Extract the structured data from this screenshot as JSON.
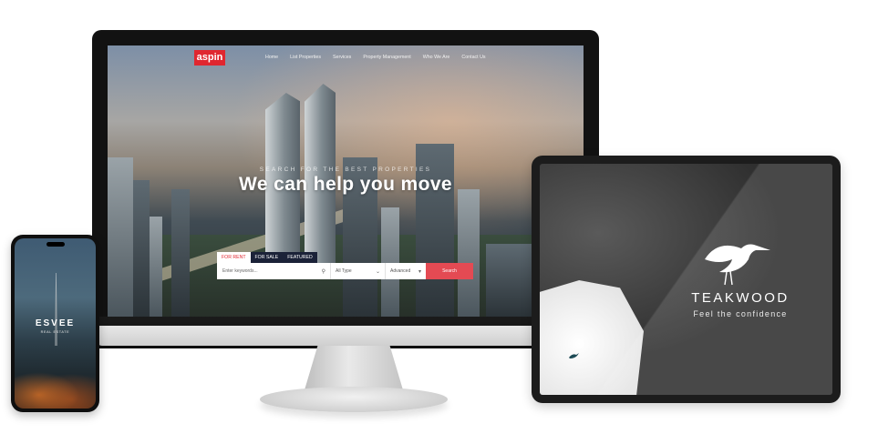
{
  "desktop": {
    "site": {
      "logo": "aspin",
      "nav": [
        "Home",
        "List Properties",
        "Services",
        "Property Management",
        "Who We Are",
        "Contact Us"
      ],
      "hero_subtitle": "SEARCH FOR THE BEST PROPERTIES",
      "hero_title": "We can help you move",
      "search": {
        "tabs": [
          {
            "label": "FOR RENT",
            "active": true
          },
          {
            "label": "FOR SALE",
            "active": false
          },
          {
            "label": "FEATURED",
            "active": false
          }
        ],
        "keyword_placeholder": "Enter keywords...",
        "type_selected": "All Type",
        "advanced_label": "Advanced",
        "submit_label": "Search"
      }
    }
  },
  "phone": {
    "brand": "ESVEE",
    "tagline": "REAL ESTATE"
  },
  "tablet": {
    "brand": "TEAKWOOD",
    "tagline": "Feel the confidence"
  },
  "colors": {
    "accent_red": "#e0262f",
    "search_button": "#e44a53",
    "tab_dark": "#1b2238"
  },
  "icons": {
    "search": "search-icon",
    "chevron": "chevron-down-icon",
    "crane": "crane-logo-icon"
  }
}
